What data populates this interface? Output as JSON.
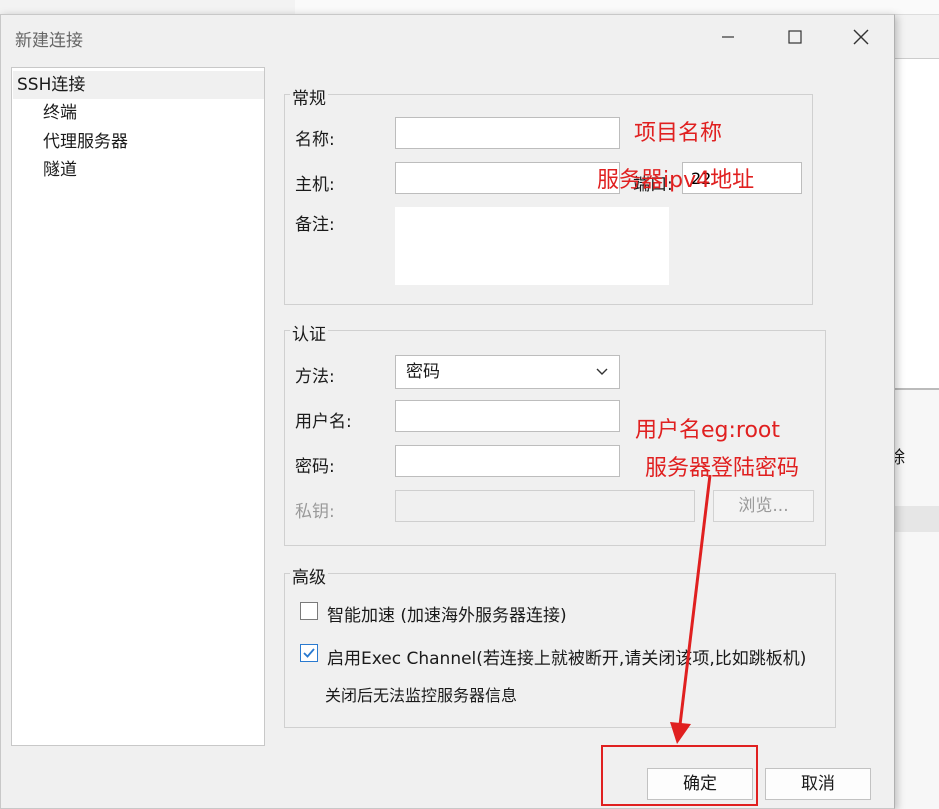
{
  "window": {
    "title": "新建连接",
    "minimize_icon": "minimize-icon",
    "maximize_icon": "maximize-icon",
    "close_icon": "close-icon"
  },
  "nav": {
    "items": [
      {
        "label": "SSH连接",
        "selected": true
      },
      {
        "label": "终端"
      },
      {
        "label": "代理服务器"
      },
      {
        "label": "隧道"
      }
    ]
  },
  "general": {
    "legend": "常规",
    "name_label": "名称:",
    "name_value": "",
    "host_label": "主机:",
    "host_value": "",
    "port_label": "端口:",
    "port_value": "22",
    "notes_label": "备注:",
    "notes_value": ""
  },
  "auth": {
    "legend": "认证",
    "method_label": "方法:",
    "method_value": "密码",
    "username_label": "用户名:",
    "username_value": "",
    "password_label": "密码:",
    "password_value": "",
    "key_label": "私钥:",
    "key_value": "",
    "browse_label": "浏览..."
  },
  "advanced": {
    "legend": "高级",
    "smart_accel_label": "智能加速 (加速海外服务器连接)",
    "smart_accel_checked": false,
    "exec_channel_label": "启用Exec Channel(若连接上就被断开,请关闭该项,比如跳板机)",
    "exec_channel_checked": true,
    "exec_channel_note": "关闭后无法监控服务器信息"
  },
  "footer": {
    "ok_label": "确定",
    "cancel_label": "取消"
  },
  "annotations": {
    "name_hint": "项目名称",
    "host_hint": "服务器ipv4地址",
    "user_hint": "用户名eg:root",
    "password_hint": "服务器登陆密码",
    "color": "#e02020"
  },
  "background": {
    "delete_text": "除"
  }
}
